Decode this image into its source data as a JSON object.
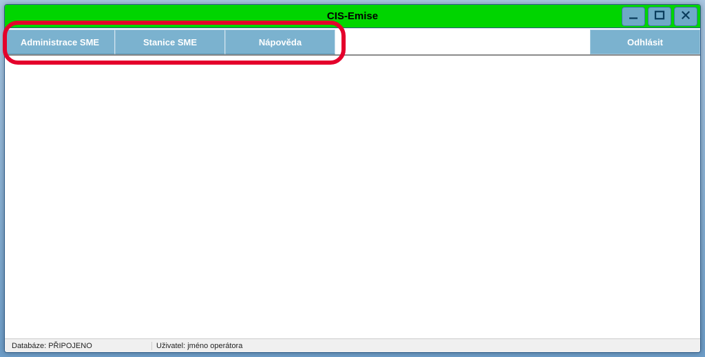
{
  "titlebar": {
    "title": "CIS-Emise"
  },
  "menu": {
    "items": [
      {
        "label": "Administrace SME"
      },
      {
        "label": "Stanice SME"
      },
      {
        "label": "Nápověda"
      }
    ],
    "logout_label": "Odhlásit"
  },
  "statusbar": {
    "db_label": "Databáze: PŘIPOJENO",
    "user_label": "Uživatel: jméno operátora"
  },
  "icons": {
    "minimize": "minimize-icon",
    "maximize": "maximize-icon",
    "close": "close-icon"
  }
}
